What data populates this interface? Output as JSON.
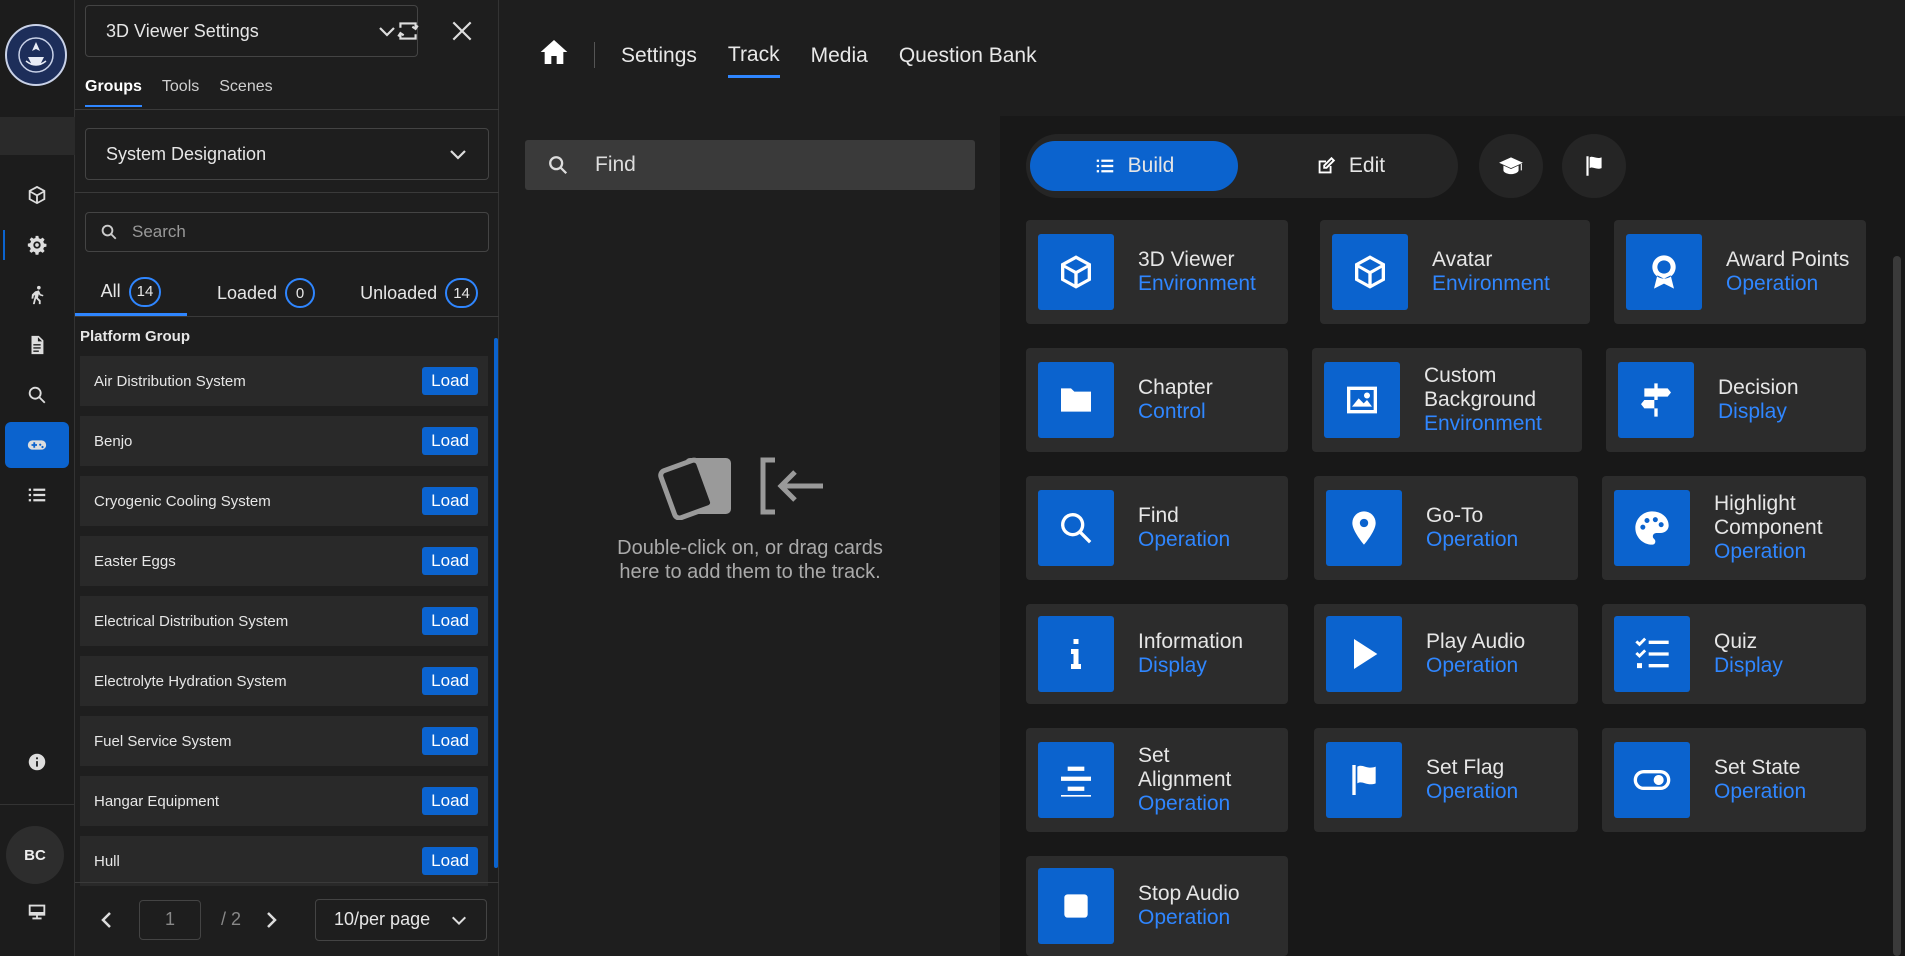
{
  "panel": {
    "title": "3D Viewer Settings",
    "subtabs": [
      "Groups",
      "Tools",
      "Scenes"
    ],
    "designation": "System Designation",
    "search_placeholder": "Search",
    "filters": [
      {
        "label": "All",
        "count": "14"
      },
      {
        "label": "Loaded",
        "count": "0"
      },
      {
        "label": "Unloaded",
        "count": "14"
      }
    ],
    "group_title": "Platform Group",
    "items": [
      "Air Distribution System",
      "Benjo",
      "Cryogenic Cooling System",
      "Easter Eggs",
      "Electrical Distribution System",
      "Electrolyte Hydration System",
      "Fuel Service System",
      "Hangar Equipment",
      "Hull"
    ],
    "load_label": "Load",
    "pager": {
      "page": "1",
      "total": "/ 2",
      "per_page": "10/per page"
    }
  },
  "user": {
    "initials": "BC"
  },
  "nav": {
    "items": [
      "Settings",
      "Track",
      "Media",
      "Question Bank"
    ],
    "active": "Track"
  },
  "find": {
    "placeholder": "Find"
  },
  "drop_hint": "Double-click on, or drag cards here to add them to the track.",
  "toolbar": {
    "build": "Build",
    "edit": "Edit"
  },
  "cards": [
    {
      "name": "3D Viewer",
      "category": "Environment",
      "icon": "cube-icon"
    },
    {
      "name": "Avatar",
      "category": "Environment",
      "icon": "cube-icon"
    },
    {
      "name": "Award Points",
      "category": "Operation",
      "icon": "award-icon"
    },
    {
      "name": "Chapter",
      "category": "Control",
      "icon": "folder-icon"
    },
    {
      "name": "Custom Background",
      "category": "Environment",
      "icon": "image-icon"
    },
    {
      "name": "Decision",
      "category": "Display",
      "icon": "signpost-icon"
    },
    {
      "name": "Find",
      "category": "Operation",
      "icon": "search-icon"
    },
    {
      "name": "Go-To",
      "category": "Operation",
      "icon": "map-pin-icon"
    },
    {
      "name": "Highlight Component",
      "category": "Operation",
      "icon": "palette-icon"
    },
    {
      "name": "Information",
      "category": "Display",
      "icon": "info-icon"
    },
    {
      "name": "Play Audio",
      "category": "Operation",
      "icon": "play-icon"
    },
    {
      "name": "Quiz",
      "category": "Display",
      "icon": "checklist-icon"
    },
    {
      "name": "Set Alignment",
      "category": "Operation",
      "icon": "align-center-icon"
    },
    {
      "name": "Set Flag",
      "category": "Operation",
      "icon": "flag-icon"
    },
    {
      "name": "Set State",
      "category": "Operation",
      "icon": "toggle-icon"
    },
    {
      "name": "Stop Audio",
      "category": "Operation",
      "icon": "stop-icon"
    }
  ],
  "colors": {
    "accent": "#0b63ce",
    "accent_text": "#2f86ff",
    "background": "#1e1e1e"
  }
}
